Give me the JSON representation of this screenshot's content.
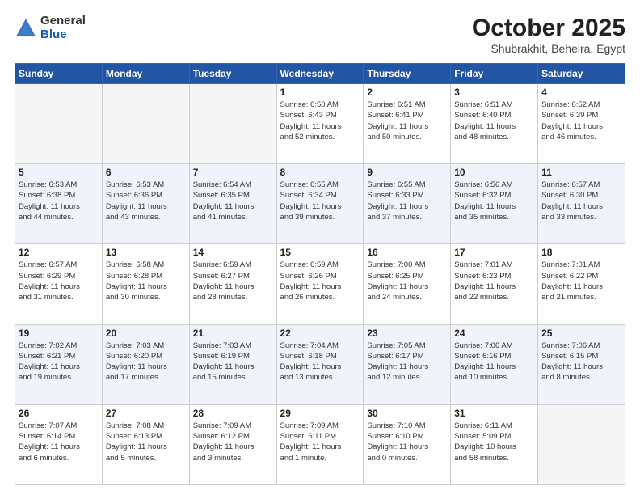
{
  "logo": {
    "general": "General",
    "blue": "Blue"
  },
  "title": "October 2025",
  "subtitle": "Shubrakhit, Beheira, Egypt",
  "weekdays": [
    "Sunday",
    "Monday",
    "Tuesday",
    "Wednesday",
    "Thursday",
    "Friday",
    "Saturday"
  ],
  "rows": [
    [
      {
        "day": "",
        "info": ""
      },
      {
        "day": "",
        "info": ""
      },
      {
        "day": "",
        "info": ""
      },
      {
        "day": "1",
        "info": "Sunrise: 6:50 AM\nSunset: 6:43 PM\nDaylight: 11 hours\nand 52 minutes."
      },
      {
        "day": "2",
        "info": "Sunrise: 6:51 AM\nSunset: 6:41 PM\nDaylight: 11 hours\nand 50 minutes."
      },
      {
        "day": "3",
        "info": "Sunrise: 6:51 AM\nSunset: 6:40 PM\nDaylight: 11 hours\nand 48 minutes."
      },
      {
        "day": "4",
        "info": "Sunrise: 6:52 AM\nSunset: 6:39 PM\nDaylight: 11 hours\nand 46 minutes."
      }
    ],
    [
      {
        "day": "5",
        "info": "Sunrise: 6:53 AM\nSunset: 6:38 PM\nDaylight: 11 hours\nand 44 minutes."
      },
      {
        "day": "6",
        "info": "Sunrise: 6:53 AM\nSunset: 6:36 PM\nDaylight: 11 hours\nand 43 minutes."
      },
      {
        "day": "7",
        "info": "Sunrise: 6:54 AM\nSunset: 6:35 PM\nDaylight: 11 hours\nand 41 minutes."
      },
      {
        "day": "8",
        "info": "Sunrise: 6:55 AM\nSunset: 6:34 PM\nDaylight: 11 hours\nand 39 minutes."
      },
      {
        "day": "9",
        "info": "Sunrise: 6:55 AM\nSunset: 6:33 PM\nDaylight: 11 hours\nand 37 minutes."
      },
      {
        "day": "10",
        "info": "Sunrise: 6:56 AM\nSunset: 6:32 PM\nDaylight: 11 hours\nand 35 minutes."
      },
      {
        "day": "11",
        "info": "Sunrise: 6:57 AM\nSunset: 6:30 PM\nDaylight: 11 hours\nand 33 minutes."
      }
    ],
    [
      {
        "day": "12",
        "info": "Sunrise: 6:57 AM\nSunset: 6:29 PM\nDaylight: 11 hours\nand 31 minutes."
      },
      {
        "day": "13",
        "info": "Sunrise: 6:58 AM\nSunset: 6:28 PM\nDaylight: 11 hours\nand 30 minutes."
      },
      {
        "day": "14",
        "info": "Sunrise: 6:59 AM\nSunset: 6:27 PM\nDaylight: 11 hours\nand 28 minutes."
      },
      {
        "day": "15",
        "info": "Sunrise: 6:59 AM\nSunset: 6:26 PM\nDaylight: 11 hours\nand 26 minutes."
      },
      {
        "day": "16",
        "info": "Sunrise: 7:00 AM\nSunset: 6:25 PM\nDaylight: 11 hours\nand 24 minutes."
      },
      {
        "day": "17",
        "info": "Sunrise: 7:01 AM\nSunset: 6:23 PM\nDaylight: 11 hours\nand 22 minutes."
      },
      {
        "day": "18",
        "info": "Sunrise: 7:01 AM\nSunset: 6:22 PM\nDaylight: 11 hours\nand 21 minutes."
      }
    ],
    [
      {
        "day": "19",
        "info": "Sunrise: 7:02 AM\nSunset: 6:21 PM\nDaylight: 11 hours\nand 19 minutes."
      },
      {
        "day": "20",
        "info": "Sunrise: 7:03 AM\nSunset: 6:20 PM\nDaylight: 11 hours\nand 17 minutes."
      },
      {
        "day": "21",
        "info": "Sunrise: 7:03 AM\nSunset: 6:19 PM\nDaylight: 11 hours\nand 15 minutes."
      },
      {
        "day": "22",
        "info": "Sunrise: 7:04 AM\nSunset: 6:18 PM\nDaylight: 11 hours\nand 13 minutes."
      },
      {
        "day": "23",
        "info": "Sunrise: 7:05 AM\nSunset: 6:17 PM\nDaylight: 11 hours\nand 12 minutes."
      },
      {
        "day": "24",
        "info": "Sunrise: 7:06 AM\nSunset: 6:16 PM\nDaylight: 11 hours\nand 10 minutes."
      },
      {
        "day": "25",
        "info": "Sunrise: 7:06 AM\nSunset: 6:15 PM\nDaylight: 11 hours\nand 8 minutes."
      }
    ],
    [
      {
        "day": "26",
        "info": "Sunrise: 7:07 AM\nSunset: 6:14 PM\nDaylight: 11 hours\nand 6 minutes."
      },
      {
        "day": "27",
        "info": "Sunrise: 7:08 AM\nSunset: 6:13 PM\nDaylight: 11 hours\nand 5 minutes."
      },
      {
        "day": "28",
        "info": "Sunrise: 7:09 AM\nSunset: 6:12 PM\nDaylight: 11 hours\nand 3 minutes."
      },
      {
        "day": "29",
        "info": "Sunrise: 7:09 AM\nSunset: 6:11 PM\nDaylight: 11 hours\nand 1 minute."
      },
      {
        "day": "30",
        "info": "Sunrise: 7:10 AM\nSunset: 6:10 PM\nDaylight: 11 hours\nand 0 minutes."
      },
      {
        "day": "31",
        "info": "Sunrise: 6:11 AM\nSunset: 5:09 PM\nDaylight: 10 hours\nand 58 minutes."
      },
      {
        "day": "",
        "info": ""
      }
    ]
  ]
}
